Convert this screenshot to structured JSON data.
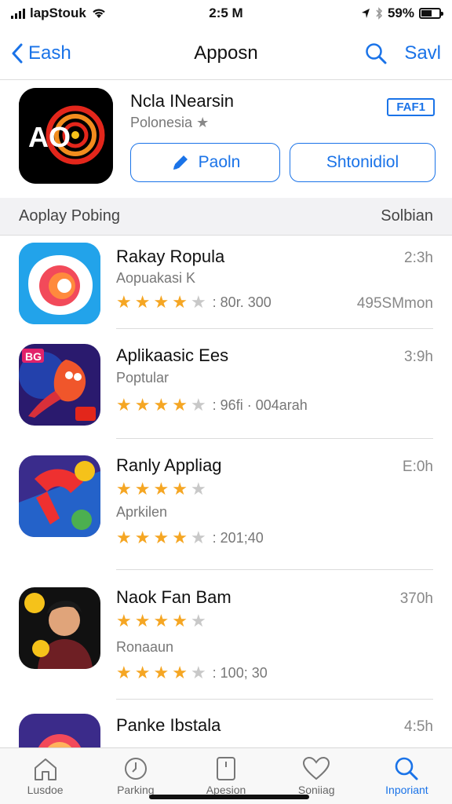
{
  "status_bar": {
    "carrier": "lapStouk",
    "time": "2:5 M",
    "battery_text": "59%",
    "battery_level": 0.59
  },
  "nav": {
    "back_label": "Eash",
    "title": "Apposn",
    "action_label": "Savl"
  },
  "featured": {
    "name": "Ncla INearsin",
    "subtitle": "Polonesia",
    "badge": "FAF1",
    "icon_text": "AO",
    "primary_button": "Paoln",
    "secondary_button": "Shtonidiol"
  },
  "section": {
    "title": "Aoplay Pobing",
    "action": "Solbian"
  },
  "apps": [
    {
      "name": "Rakay Ropula",
      "meta": "2:3h",
      "subtitle": "Aopuakasi K",
      "rating_text": ": 80r. 300",
      "extra": "495SMmon",
      "rating": 4
    },
    {
      "name": "Aplikaasic Ees",
      "meta": "3:9h",
      "subtitle": "Poptular",
      "rating_text": ": 96fi · 004arah",
      "extra": "",
      "rating": 4
    },
    {
      "name": "Ranly Appliag",
      "meta": "E:0h",
      "subtitle": "Aprkilen",
      "rating_text": ": 201;40",
      "extra": "",
      "rating": 4
    },
    {
      "name": "Naok Fan Bam",
      "meta": "370h",
      "subtitle": "Ronaaun",
      "rating_text": ": 100; 30",
      "extra": "",
      "rating": 4
    },
    {
      "name": "Panke Ibstala",
      "meta": "4:5h",
      "subtitle": "",
      "rating_text": "",
      "extra": "",
      "rating": 0
    }
  ],
  "tabs": [
    {
      "label": "Lusdoe",
      "icon": "home-icon"
    },
    {
      "label": "Parking",
      "icon": "clock-icon"
    },
    {
      "label": "Apesion",
      "icon": "card-icon"
    },
    {
      "label": "Soniiag",
      "icon": "heart-icon"
    },
    {
      "label": "Inporiant",
      "icon": "search-icon"
    }
  ],
  "colors": {
    "accent": "#1a73e8",
    "star": "#f5a623"
  }
}
